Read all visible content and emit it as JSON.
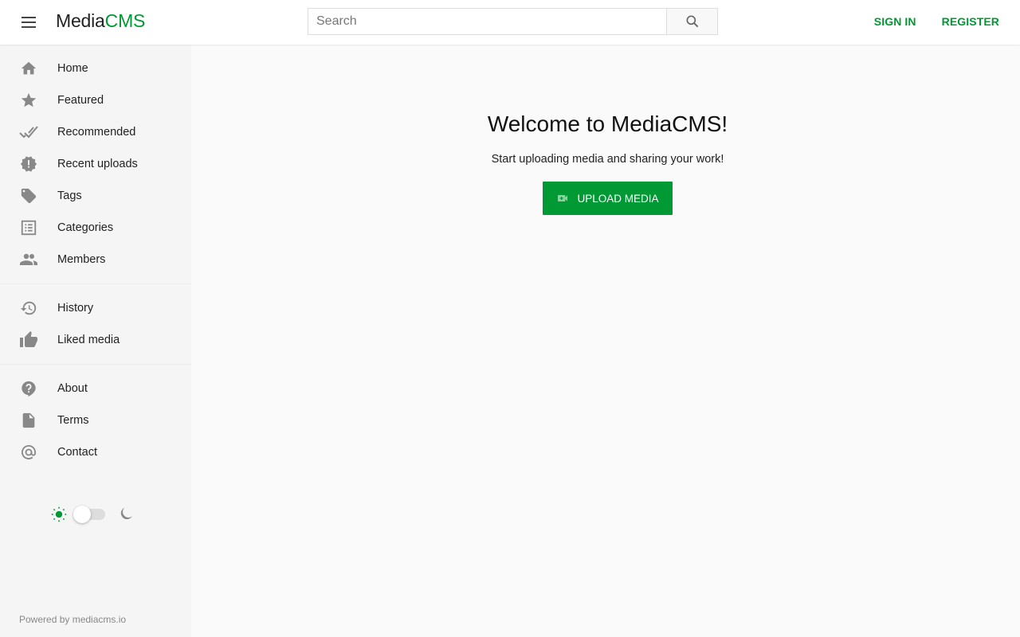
{
  "header": {
    "menu_icon": "hamburger-menu-icon",
    "logo_part1": "Media",
    "logo_part2": "CMS",
    "search": {
      "placeholder": "Search",
      "value": "",
      "icon": "search-icon"
    },
    "sign_in": "SIGN IN",
    "register": "REGISTER"
  },
  "sidebar": {
    "groups": [
      {
        "items": [
          {
            "label": "Home",
            "icon": "home-icon"
          },
          {
            "label": "Featured",
            "icon": "star-icon"
          },
          {
            "label": "Recommended",
            "icon": "double-check-icon"
          },
          {
            "label": "Recent uploads",
            "icon": "new-releases-icon"
          },
          {
            "label": "Tags",
            "icon": "tag-icon"
          },
          {
            "label": "Categories",
            "icon": "list-icon"
          },
          {
            "label": "Members",
            "icon": "people-icon"
          }
        ]
      },
      {
        "items": [
          {
            "label": "History",
            "icon": "history-icon"
          },
          {
            "label": "Liked media",
            "icon": "thumb-up-icon"
          }
        ]
      },
      {
        "items": [
          {
            "label": "About",
            "icon": "help-icon"
          },
          {
            "label": "Terms",
            "icon": "document-icon"
          },
          {
            "label": "Contact",
            "icon": "at-sign-icon"
          }
        ]
      }
    ],
    "theme": {
      "mode": "light",
      "light_icon": "sun-icon",
      "dark_icon": "moon-icon"
    },
    "powered_by": "Powered by mediacms.io"
  },
  "main": {
    "title": "Welcome to MediaCMS!",
    "subtitle": "Start uploading media and sharing your work!",
    "upload_button": {
      "label": "UPLOAD MEDIA",
      "icon": "video-call-icon"
    }
  },
  "colors": {
    "accent": "#009933",
    "icon_gray": "#888888"
  }
}
